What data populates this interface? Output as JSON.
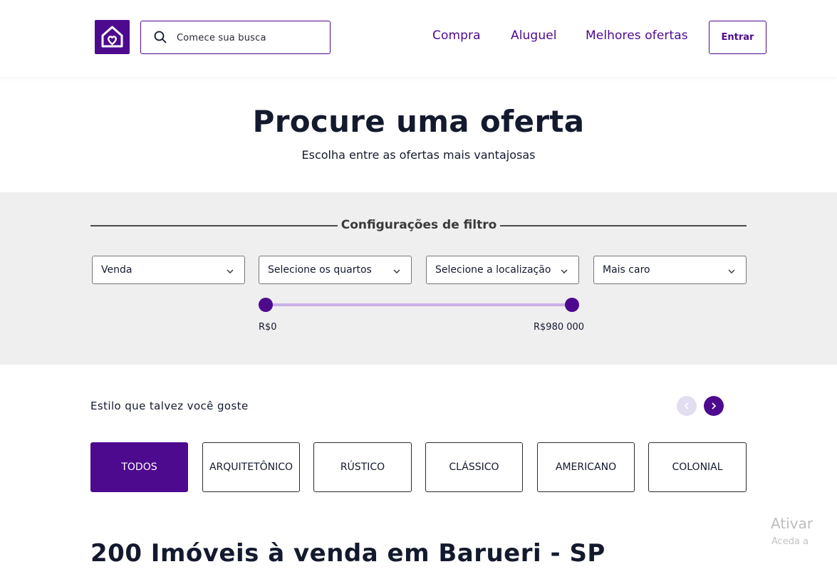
{
  "colors": {
    "brand": "#4d0a8f",
    "brand_light": "#c9b0e8",
    "text": "#141a2e",
    "filter_bg": "#efefef"
  },
  "header": {
    "logo_icon": "house-heart-icon",
    "search": {
      "placeholder": "Comece sua busca",
      "icon": "search-icon"
    },
    "nav": {
      "compra": "Compra",
      "aluguel": "Aluguel",
      "ofertas": "Melhores ofertas"
    },
    "login_label": "Entrar"
  },
  "hero": {
    "title": "Procure uma oferta",
    "subtitle": "Escolha entre as ofertas mais vantajosas"
  },
  "filters": {
    "title": "Configurações de filtro",
    "selects": {
      "type": "Venda",
      "rooms": "Selecione os quartos",
      "location": "Selecione a localização",
      "sort": "Mais caro"
    },
    "price_range": {
      "min_label": "R$0",
      "max_label": "R$980 000",
      "min_fraction": 0,
      "max_fraction": 1
    }
  },
  "styles_section": {
    "label": "Estilo que talvez você goste",
    "chips": {
      "todos": "TODOS",
      "arquitetonico": "ARQUITETÔNICO",
      "rustico": "RÚSTICO",
      "classico": "CLÁSSICO",
      "americano": "AMERICANO",
      "colonial": "COLONIAL"
    },
    "active_chip": "TODOS"
  },
  "listing": {
    "title": "200 Imóveis à venda em Barueri - SP"
  },
  "watermark": {
    "title": "Ativar",
    "subtitle": "Aceda a"
  }
}
